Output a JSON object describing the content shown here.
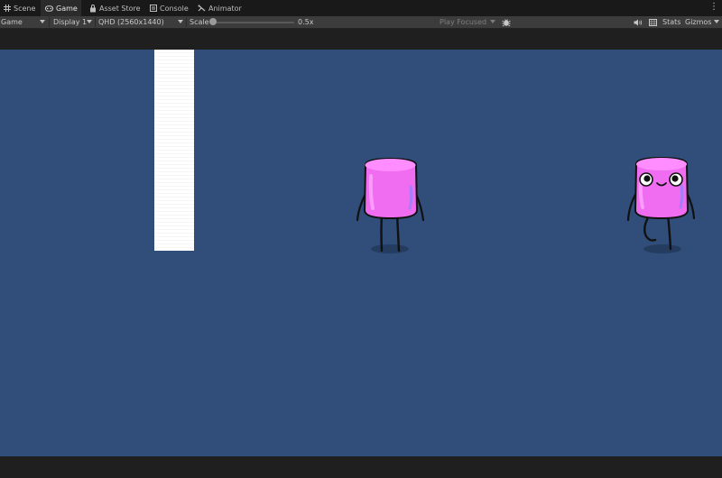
{
  "tabs": [
    {
      "label": "Scene",
      "icon": "scene-grid-icon",
      "active": false
    },
    {
      "label": "Game",
      "icon": "gamepad-icon",
      "active": true
    },
    {
      "label": "Asset Store",
      "icon": "lock-bag-icon",
      "active": false
    },
    {
      "label": "Console",
      "icon": "console-icon",
      "active": false
    },
    {
      "label": "Animator",
      "icon": "animator-icon",
      "active": false
    }
  ],
  "toolbar": {
    "game_dropdown": "Game",
    "display_dropdown": "Display 1",
    "resolution_dropdown": "QHD (2560x1440)",
    "scale_label": "Scale",
    "scale_value": "0.5x",
    "play_mode_dropdown": "Play Focused",
    "stats_label": "Stats",
    "gizmos_label": "Gizmos"
  },
  "colors": {
    "game_background": "#314d79",
    "character_body": "#f06cf0",
    "character_highlight": "#ffb0ff"
  }
}
